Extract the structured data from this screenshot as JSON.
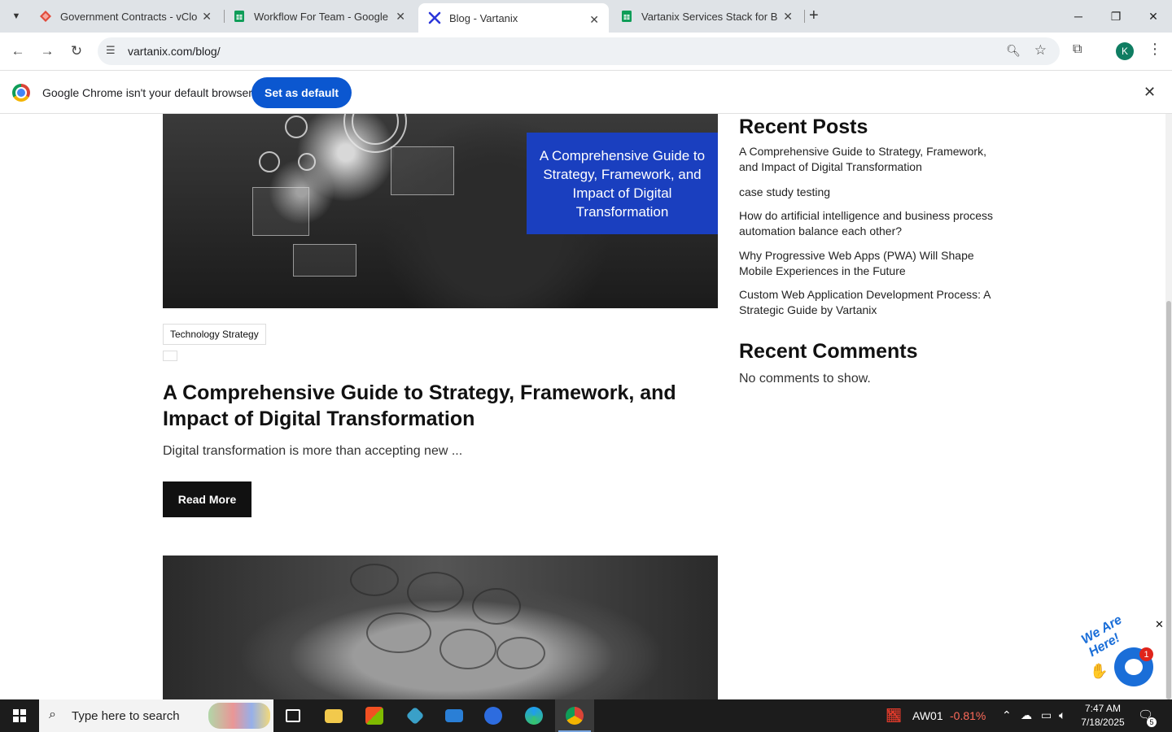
{
  "browser": {
    "tabs": [
      {
        "title": "Government Contracts - vCloud",
        "favicon": "vcloud-icon",
        "color": "#e14b3b"
      },
      {
        "title": "Workflow For Team - Google Sh",
        "favicon": "google-sheets-icon",
        "color": "#0f9d58"
      },
      {
        "title": "Blog - Vartanix",
        "favicon": "vartanix-icon",
        "color": "#2b36d9"
      },
      {
        "title": "Vartanix Services Stack for Blog",
        "favicon": "google-sheets-icon",
        "color": "#0f9d58"
      }
    ],
    "active_tab": 2,
    "url": "vartanix.com/blog/",
    "profile_initial": "K",
    "profile_color": "#0f7d62"
  },
  "infobar": {
    "message": "Google Chrome isn't your default browser",
    "button": "Set as default"
  },
  "post": {
    "image_overlay": "A Comprehensive Guide to Strategy, Framework, and Impact of Digital Transformation",
    "category": "Technology Strategy",
    "title": "A Comprehensive Guide to Strategy, Framework, and Impact of Digital Transformation",
    "excerpt": "Digital transformation is more than accepting new ...",
    "read_more": "Read More"
  },
  "sidebar": {
    "recent_posts_heading": "Recent Posts",
    "recent_posts": [
      "A Comprehensive Guide to Strategy, Framework, and Impact of Digital Transformation",
      "case study testing",
      "How do artificial intelligence and business process automation balance each other?",
      "Why Progressive Web Apps (PWA) Will Shape Mobile Experiences in the Future",
      "Custom Web Application Development Process: A Strategic Guide by Vartanix"
    ],
    "recent_comments_heading": "Recent Comments",
    "no_comments": "No comments to show."
  },
  "chat_widget": {
    "label": "We Are Here!",
    "unread_count": "1"
  },
  "taskbar": {
    "search_placeholder": "Type here to search",
    "stock_name": "AW01",
    "stock_change": "-0.81%",
    "time": "7:47 AM",
    "date": "7/18/2025",
    "notification_count": "5"
  }
}
